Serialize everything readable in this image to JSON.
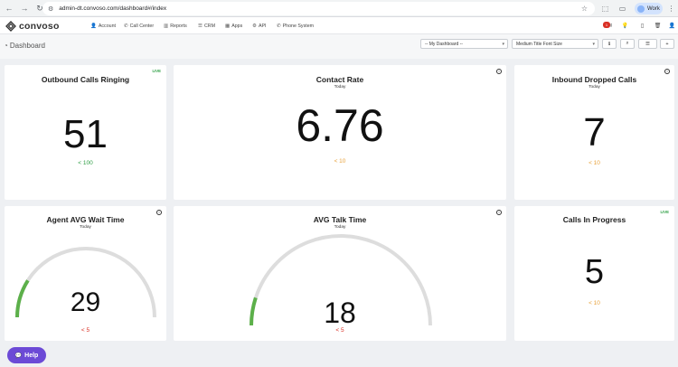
{
  "browser": {
    "url": "admin-dt.convoso.com/dashboard#/index",
    "profile_label": "Work"
  },
  "app": {
    "brand": "convoso",
    "nav": [
      "Account",
      "Call Center",
      "Reports",
      "CRM",
      "Apps",
      "API",
      "Phone System"
    ],
    "notification_count": "1"
  },
  "dashboard": {
    "title": "Dashboard",
    "selector_value": "-- My Dashboard --",
    "font_size_value": "Medium Title Font Size"
  },
  "widgets": [
    {
      "title": "Outbound Calls Ringing",
      "subtitle": "",
      "value": "51",
      "threshold": "< 100",
      "threshold_color": "#2e9e44",
      "badge": "LIVE"
    },
    {
      "title": "Contact Rate",
      "subtitle": "Today",
      "value": "6.76",
      "threshold": "< 10",
      "threshold_color": "#e8a33d",
      "badge": ""
    },
    {
      "title": "Inbound Dropped Calls",
      "subtitle": "Today",
      "value": "7",
      "threshold": "< 10",
      "threshold_color": "#e8a33d",
      "badge": ""
    },
    {
      "title": "Agent AVG Wait Time",
      "subtitle": "Today",
      "value": "29",
      "threshold": "< 5",
      "threshold_color": "#d93025",
      "badge": "",
      "gauge_fraction": 0.18
    },
    {
      "title": "AVG Talk Time",
      "subtitle": "Today",
      "value": "18",
      "threshold": "< 5",
      "threshold_color": "#d93025",
      "badge": "",
      "gauge_fraction": 0.1
    },
    {
      "title": "Calls In Progress",
      "subtitle": "",
      "value": "5",
      "threshold": "< 10",
      "threshold_color": "#e8a33d",
      "badge": "LIVE"
    }
  ],
  "help": {
    "label": "Help"
  },
  "colors": {
    "gauge_fill": "#5cb04a",
    "gauge_track": "#dddddd",
    "help_bg": "#6c4ad6"
  }
}
